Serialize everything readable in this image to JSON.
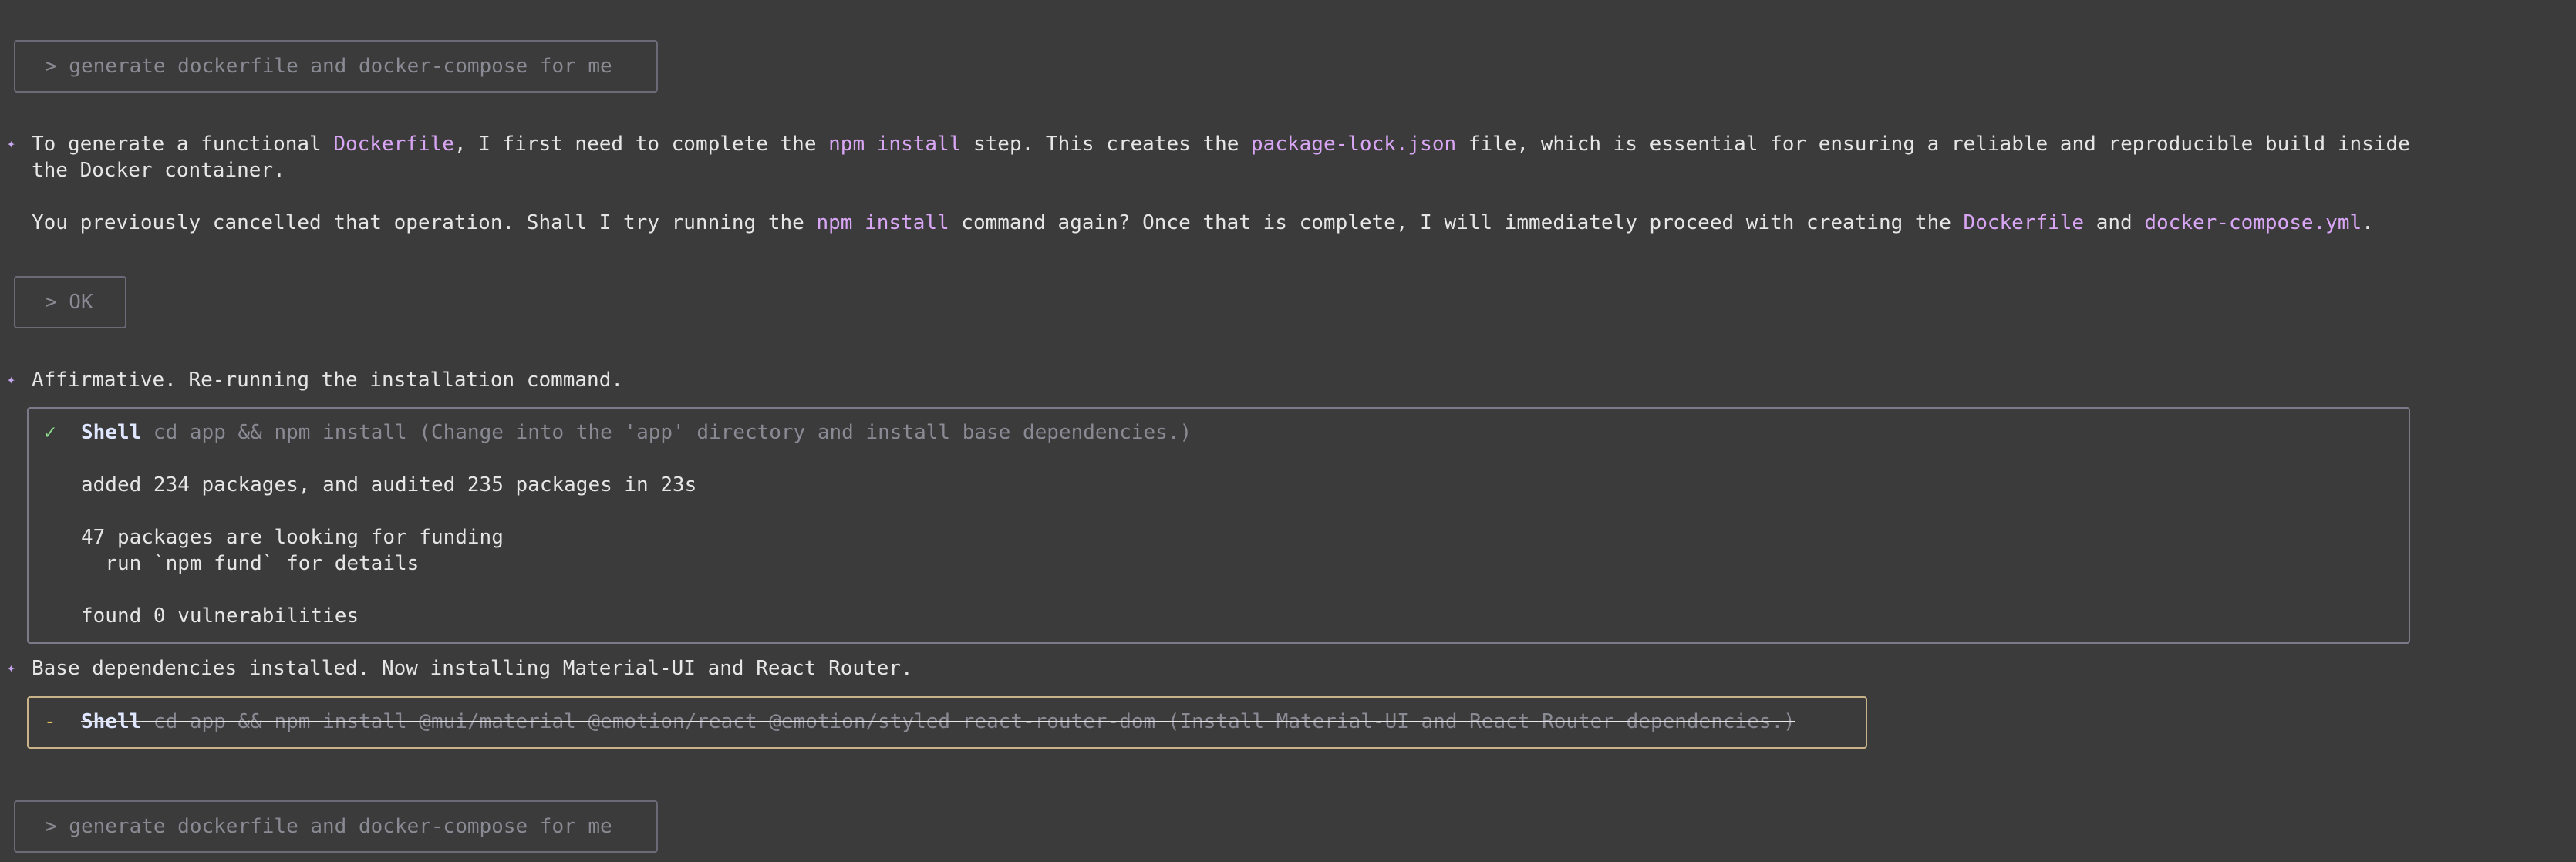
{
  "prompts": {
    "first": "> generate dockerfile and docker-compose for me",
    "ok": "> OK",
    "last": "> generate dockerfile and docker-compose for me"
  },
  "messages": {
    "m1": {
      "a": "To generate a functional ",
      "b": "Dockerfile",
      "c": ", I first need to complete the ",
      "d": "npm install",
      "e": " step. This creates the ",
      "f": "package-lock.json",
      "g": " file, which is essential for ensuring a reliable and reproducible build inside",
      "line2": "the Docker container."
    },
    "m2": {
      "a": "You previously cancelled that operation. Shall I try running the ",
      "b": "npm install",
      "c": " command again? Once that is complete, I will immediately proceed with creating the ",
      "d": "Dockerfile",
      "e": " and ",
      "f": "docker-compose.yml",
      "g": "."
    },
    "m3": "Affirmative. Re-running the installation command.",
    "m4": "Base dependencies installed. Now installing Material-UI and React Router."
  },
  "tool1": {
    "status_icon": "✓",
    "name": "Shell",
    "description": " cd app && npm install (Change into the 'app' directory and install base dependencies.)",
    "output": [
      "added 234 packages, and audited 235 packages in 23s",
      "47 packages are looking for funding",
      "  run `npm fund` for details",
      "found 0 vulnerabilities"
    ]
  },
  "tool2": {
    "status_icon": "-",
    "name": "Shell",
    "description": " cd app && npm install @mui/material @emotion/react @emotion/styled react-router-dom (Install Material-UI and React Router dependencies.)"
  },
  "icons": {
    "assistant_marker": "✦"
  },
  "colors": {
    "background": "#3b3b3b",
    "highlight": "#d9a6f5",
    "success": "#8bd68b",
    "pending": "#e8c25a"
  }
}
